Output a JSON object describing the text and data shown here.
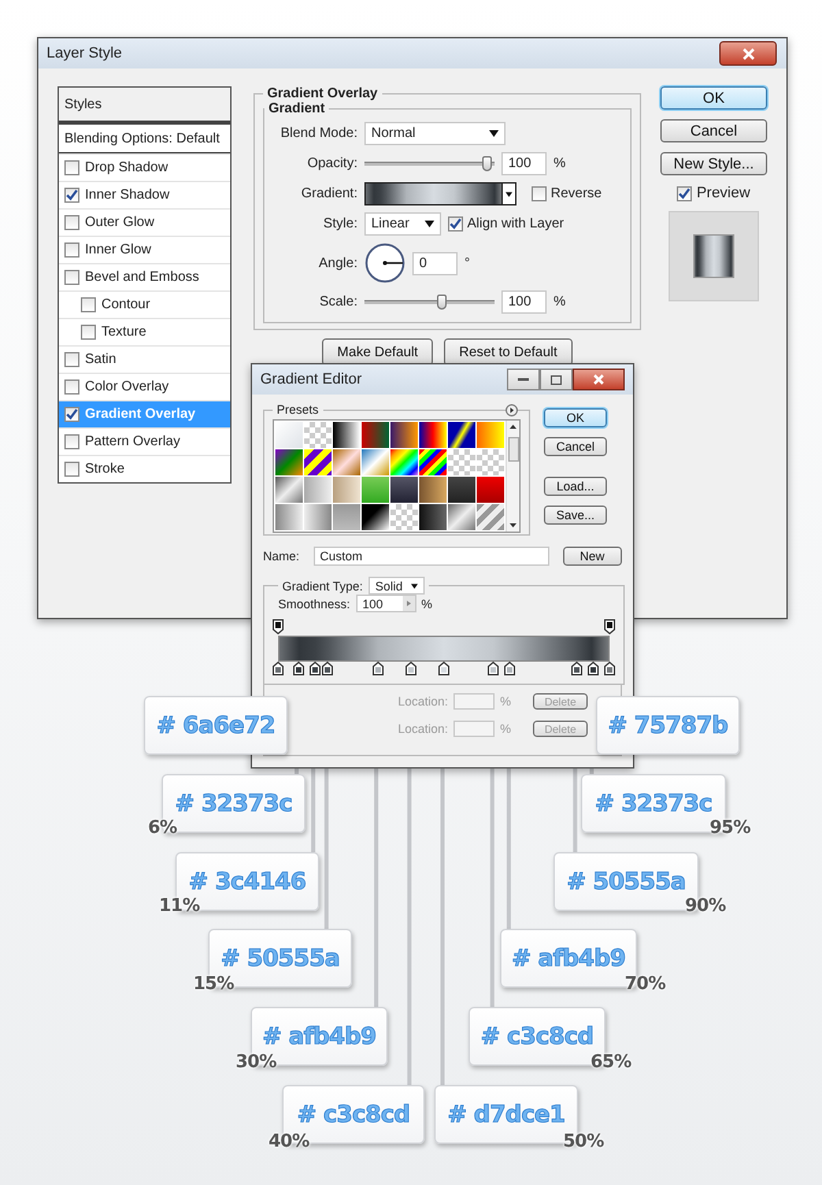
{
  "window": {
    "title": "Layer Style"
  },
  "styles_list": {
    "header": "Styles",
    "items": [
      {
        "label": "Blending Options: Default",
        "kind": "heading",
        "selected": false
      },
      {
        "label": "Drop Shadow",
        "kind": "checkbox",
        "checked": false,
        "selected": false
      },
      {
        "label": "Inner Shadow",
        "kind": "checkbox",
        "checked": true,
        "selected": false
      },
      {
        "label": "Outer Glow",
        "kind": "checkbox",
        "checked": false,
        "selected": false
      },
      {
        "label": "Inner Glow",
        "kind": "checkbox",
        "checked": false,
        "selected": false
      },
      {
        "label": "Bevel and Emboss",
        "kind": "checkbox",
        "checked": false,
        "selected": false,
        "children": [
          {
            "label": "Contour",
            "kind": "checkbox",
            "checked": false,
            "selected": false
          },
          {
            "label": "Texture",
            "kind": "checkbox",
            "checked": false,
            "selected": false
          }
        ]
      },
      {
        "label": "Satin",
        "kind": "checkbox",
        "checked": false,
        "selected": false
      },
      {
        "label": "Color Overlay",
        "kind": "checkbox",
        "checked": false,
        "selected": false
      },
      {
        "label": "Gradient Overlay",
        "kind": "checkbox",
        "checked": true,
        "selected": true
      },
      {
        "label": "Pattern Overlay",
        "kind": "checkbox",
        "checked": false,
        "selected": false
      },
      {
        "label": "Stroke",
        "kind": "checkbox",
        "checked": false,
        "selected": false
      }
    ]
  },
  "gradient_overlay": {
    "title": "Gradient Overlay",
    "group_title": "Gradient",
    "blend_mode": {
      "label": "Blend Mode:",
      "value": "Normal"
    },
    "opacity": {
      "label": "Opacity:",
      "level": 0.95,
      "value": "100",
      "unit": "%"
    },
    "gradient": {
      "label": "Gradient:",
      "reverse": {
        "label": "Reverse",
        "checked": false
      }
    },
    "style": {
      "label": "Style:",
      "value": "Linear",
      "align": {
        "label": "Align with Layer",
        "checked": true
      }
    },
    "angle": {
      "label": "Angle:",
      "value": "0",
      "unit": "°"
    },
    "scale": {
      "label": "Scale:",
      "level": 0.6,
      "value": "100",
      "unit": "%"
    },
    "buttons": [
      "Make Default",
      "Reset to Default"
    ]
  },
  "actions": {
    "buttons": [
      {
        "label": "OK",
        "default": true
      },
      {
        "label": "Cancel",
        "default": false
      },
      {
        "label": "New Style...",
        "default": false
      }
    ],
    "preview": {
      "label": "Preview",
      "checked": true
    }
  },
  "gradient_editor": {
    "title": "Gradient Editor",
    "presets_label": "Presets",
    "buttons": [
      {
        "label": "OK",
        "default": true
      },
      {
        "label": "Cancel",
        "default": false
      },
      {
        "label": "Load...",
        "default": false
      },
      {
        "label": "Save...",
        "default": false
      }
    ],
    "name_label": "Name:",
    "name_value": "Custom",
    "new_button": "New",
    "type_label": "Gradient Type:",
    "type_value": "Solid",
    "smoothness_label": "Smoothness:",
    "smoothness_value": "100",
    "smoothness_unit": "%",
    "stop_rows": [
      {
        "label": "Location:",
        "unit": "%",
        "button": "Delete"
      },
      {
        "label": "Location:",
        "unit": "%",
        "button": "Delete"
      }
    ]
  },
  "callouts": [
    {
      "hex": "# 6a6e72"
    },
    {
      "hex": "# 75787b"
    },
    {
      "hex": "# 32373c",
      "percent": "6%"
    },
    {
      "hex": "# 32373c",
      "percent": "95%"
    },
    {
      "hex": "# 3c4146",
      "percent": "11%"
    },
    {
      "hex": "# 50555a",
      "percent": "90%"
    },
    {
      "hex": "# 50555a",
      "percent": "15%"
    },
    {
      "hex": "# afb4b9",
      "percent": "70%"
    },
    {
      "hex": "# afb4b9",
      "percent": "30%"
    },
    {
      "hex": "# c3c8cd",
      "percent": "65%"
    },
    {
      "hex": "# c3c8cd",
      "percent": "40%"
    },
    {
      "hex": "# d7dce1",
      "percent": "50%"
    }
  ]
}
